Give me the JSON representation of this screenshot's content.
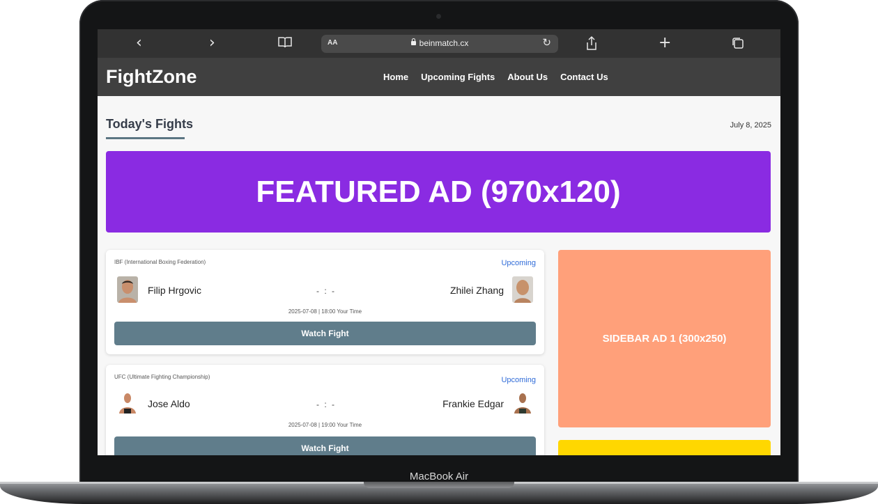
{
  "device": {
    "label": "MacBook Air"
  },
  "browser": {
    "reader_label": "AA",
    "url": "beinmatch.cx"
  },
  "site": {
    "logo": "FightZone",
    "menu": [
      "Home",
      "Upcoming Fights",
      "About Us",
      "Contact Us"
    ]
  },
  "page": {
    "heading": "Today's Fights",
    "date": "July 8, 2025",
    "featured_ad": "FEATURED AD (970x120)",
    "sidebar_ad_1": "SIDEBAR AD 1 (300x250)"
  },
  "fights": [
    {
      "organization": "IBF (International Boxing Federation)",
      "status": "Upcoming",
      "fighter_left": "Filip Hrgovic",
      "fighter_right": "Zhilei Zhang",
      "score": "- : -",
      "time": "2025-07-08 | 18:00 Your Time",
      "button": "Watch Fight"
    },
    {
      "organization": "UFC (Ultimate Fighting Championship)",
      "status": "Upcoming",
      "fighter_left": "Jose Aldo",
      "fighter_right": "Frankie Edgar",
      "score": "- : -",
      "time": "2025-07-08 | 19:00 Your Time",
      "button": "Watch Fight"
    }
  ],
  "colors": {
    "nav_bg": "#404040",
    "featured_ad": "#8a2be2",
    "sidebar_ad_1": "#ffa07a",
    "sidebar_ad_2": "#ffd700",
    "watch_button": "#607d8b",
    "status_link": "#2f6bd8"
  },
  "icons": [
    "back-icon",
    "forward-icon",
    "bookmarks-icon",
    "lock-icon",
    "reload-icon",
    "share-icon",
    "new-tab-icon",
    "tabs-icon"
  ]
}
